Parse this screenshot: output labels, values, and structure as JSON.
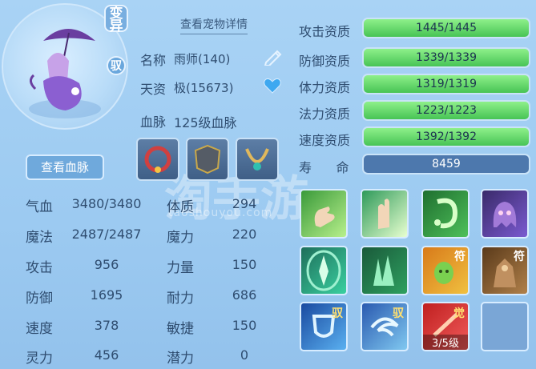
{
  "badges": {
    "variant": "变\n异",
    "tame": "驭"
  },
  "pet": {
    "detail_link": "查看宠物详情",
    "name_label": "名称",
    "name_value": "雨师(140)",
    "aptitude_label": "天资",
    "aptitude_value": "极(15673)",
    "bloodline_label": "血脉",
    "bloodline_value": "125级血脉",
    "view_bloodline": "查看血脉"
  },
  "attributes": {
    "left": [
      {
        "label": "气血",
        "value": "3480/3480"
      },
      {
        "label": "魔法",
        "value": "2487/2487"
      },
      {
        "label": "攻击",
        "value": "956"
      },
      {
        "label": "防御",
        "value": "1695"
      },
      {
        "label": "速度",
        "value": "378"
      },
      {
        "label": "灵力",
        "value": "456"
      }
    ],
    "right": [
      {
        "label": "体质",
        "value": "294"
      },
      {
        "label": "魔力",
        "value": "220"
      },
      {
        "label": "力量",
        "value": "150"
      },
      {
        "label": "耐力",
        "value": "686"
      },
      {
        "label": "敏捷",
        "value": "150"
      },
      {
        "label": "潜力",
        "value": "0"
      }
    ]
  },
  "aptitudes": [
    {
      "label": "攻击资质",
      "text": "1445/1445",
      "fraction": 1.0
    },
    {
      "label": "防御资质",
      "text": "1339/1339",
      "fraction": 1.0
    },
    {
      "label": "体力资质",
      "text": "1319/1319",
      "fraction": 1.0
    },
    {
      "label": "法力资质",
      "text": "1223/1223",
      "fraction": 1.0
    },
    {
      "label": "速度资质",
      "text": "1392/1392",
      "fraction": 1.0
    }
  ],
  "lifespan": {
    "label": "寿      命",
    "value": "8459"
  },
  "skills": {
    "tag_fu": "符",
    "tag_yu": "驭",
    "tag_jue": "觉",
    "level": "3/5级"
  },
  "watermark": {
    "main": "淘手游",
    "sub": "taoshouyou.com"
  },
  "colors": {
    "bar_fill": "#5ad060",
    "bar_bg": "#4b82bb",
    "panel": "#9ccaf1"
  }
}
